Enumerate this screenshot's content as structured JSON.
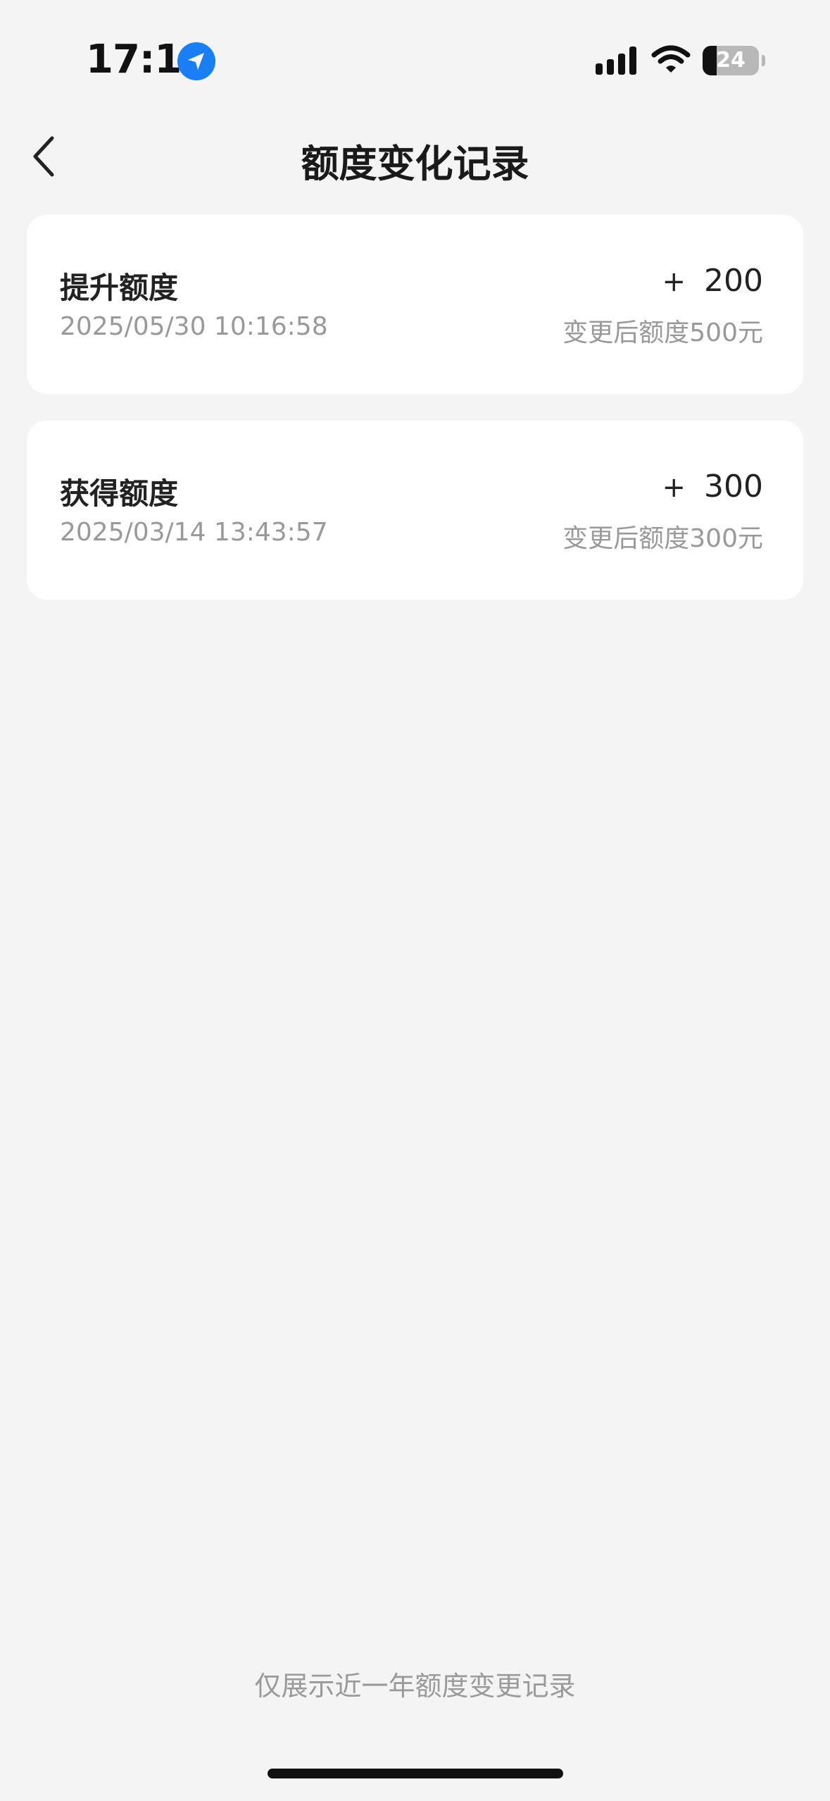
{
  "status_bar": {
    "time": "17:16",
    "battery": "24",
    "icons": [
      "location-arrow-icon",
      "cellular-signal-icon",
      "wifi-icon",
      "battery-icon"
    ]
  },
  "nav": {
    "title": "额度变化记录",
    "back_icon": "chevron-left-icon"
  },
  "records": [
    {
      "type": "提升额度",
      "time": "2025/05/30 10:16:58",
      "sign": "+",
      "amount": "200",
      "balance_text": "变更后额度500元"
    },
    {
      "type": "获得额度",
      "time": "2025/03/14 13:43:57",
      "sign": "+",
      "amount": "300",
      "balance_text": "变更后额度300元"
    }
  ],
  "footer_note": "仅展示近一年额度变更记录",
  "colors": {
    "background": "#f4f4f4",
    "card": "#ffffff",
    "accent_blue": "#1a7ef5",
    "muted_text": "#999999"
  }
}
